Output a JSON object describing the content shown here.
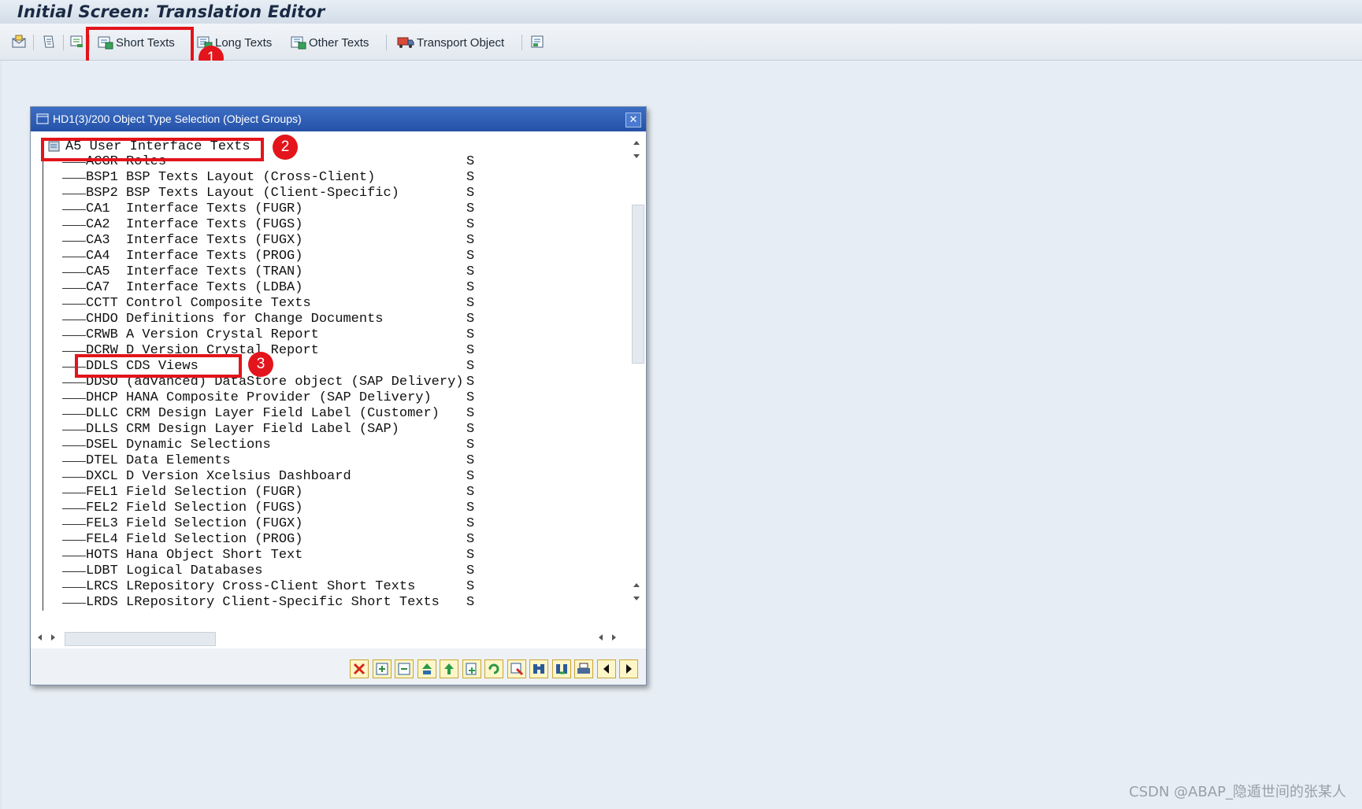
{
  "window": {
    "title": "Initial Screen: Translation Editor"
  },
  "toolbar": {
    "short_texts": "Short Texts",
    "long_texts": "Long Texts",
    "other_texts": "Other Texts",
    "transport_object": "Transport Object"
  },
  "annotations": {
    "one": "1",
    "two": "2",
    "three": "3"
  },
  "dialog": {
    "title": "HD1(3)/200 Object Type Selection (Object Groups)",
    "close": "✕",
    "root_label": "A5 User Interface Texts",
    "rows": [
      {
        "code": "ACGR",
        "text": "Roles",
        "flag": "S"
      },
      {
        "code": "BSP1",
        "text": "BSP Texts Layout (Cross-Client)",
        "flag": "S"
      },
      {
        "code": "BSP2",
        "text": "BSP Texts Layout (Client-Specific)",
        "flag": "S"
      },
      {
        "code": "CA1 ",
        "text": "Interface Texts (FUGR)",
        "flag": "S"
      },
      {
        "code": "CA2 ",
        "text": "Interface Texts (FUGS)",
        "flag": "S"
      },
      {
        "code": "CA3 ",
        "text": "Interface Texts (FUGX)",
        "flag": "S"
      },
      {
        "code": "CA4 ",
        "text": "Interface Texts (PROG)",
        "flag": "S"
      },
      {
        "code": "CA5 ",
        "text": "Interface Texts (TRAN)",
        "flag": "S"
      },
      {
        "code": "CA7 ",
        "text": "Interface Texts (LDBA)",
        "flag": "S"
      },
      {
        "code": "CCTT",
        "text": "Control Composite Texts",
        "flag": "S"
      },
      {
        "code": "CHDO",
        "text": "Definitions for Change Documents",
        "flag": "S"
      },
      {
        "code": "CRWB",
        "text": "A Version Crystal Report",
        "flag": "S"
      },
      {
        "code": "DCRW",
        "text": "D Version Crystal Report",
        "flag": "S"
      },
      {
        "code": "DDLS",
        "text": "CDS Views",
        "flag": "S"
      },
      {
        "code": "DDSO",
        "text": "(advanced) DataStore object (SAP Delivery)",
        "flag": "S"
      },
      {
        "code": "DHCP",
        "text": "HANA Composite Provider (SAP Delivery)",
        "flag": "S"
      },
      {
        "code": "DLLC",
        "text": "CRM Design Layer Field Label (Customer)",
        "flag": "S"
      },
      {
        "code": "DLLS",
        "text": "CRM Design Layer Field Label (SAP)",
        "flag": "S"
      },
      {
        "code": "DSEL",
        "text": "Dynamic Selections",
        "flag": "S"
      },
      {
        "code": "DTEL",
        "text": "Data Elements",
        "flag": "S"
      },
      {
        "code": "DXCL",
        "text": "D Version Xcelsius Dashboard",
        "flag": "S"
      },
      {
        "code": "FEL1",
        "text": "Field Selection (FUGR)",
        "flag": "S"
      },
      {
        "code": "FEL2",
        "text": "Field Selection (FUGS)",
        "flag": "S"
      },
      {
        "code": "FEL3",
        "text": "Field Selection (FUGX)",
        "flag": "S"
      },
      {
        "code": "FEL4",
        "text": "Field Selection (PROG)",
        "flag": "S"
      },
      {
        "code": "HOTS",
        "text": "Hana Object Short Text",
        "flag": "S"
      },
      {
        "code": "LDBT",
        "text": "Logical Databases",
        "flag": "S"
      },
      {
        "code": "LRCS",
        "text": "LRepository Cross-Client Short Texts",
        "flag": "S"
      },
      {
        "code": "LRDS",
        "text": "LRepository Client-Specific Short Texts",
        "flag": "S"
      }
    ],
    "footer_buttons": [
      "cancel-icon",
      "expand-all-icon",
      "collapse-all-icon",
      "expand-subtree-icon",
      "collapse-subtree-icon",
      "select-icon",
      "refresh-icon",
      "zoom-icon",
      "find-icon",
      "find-next-icon",
      "print-icon",
      "page-left-icon",
      "page-right-icon"
    ]
  },
  "watermark": "CSDN @ABAP_隐遁世间的张某人"
}
